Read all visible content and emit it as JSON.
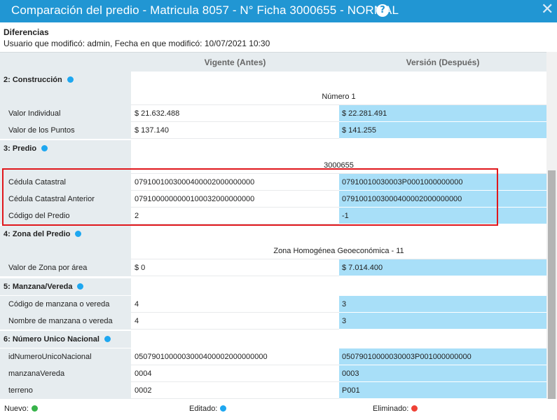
{
  "window": {
    "title": "Comparación del predio - Matricula 8057 - N° Ficha 3000655 - NORMAL",
    "help_icon": "?",
    "close_icon": "✕"
  },
  "info": {
    "heading": "Diferencias",
    "user_line": "Usuario que modificó: admin, Fecha en que modificó: 10/07/2021 10:30"
  },
  "columns": {
    "before": "Vigente (Antes)",
    "after": "Versión (Después)"
  },
  "sections": {
    "s2": {
      "title": "2: Construcción",
      "sub": "Número 1"
    },
    "s3": {
      "title": "3: Predio",
      "sub": "3000655"
    },
    "s4": {
      "title": "4: Zona del Predio",
      "sub": "Zona Homogénea Geoeconómica - 11"
    },
    "s5": {
      "title": "5: Manzana/Vereda"
    },
    "s6": {
      "title": "6: Número Unico Nacional"
    }
  },
  "rows": {
    "valor_individual": {
      "label": "Valor Individual",
      "before": "$ 21.632.488",
      "after": "$ 22.281.491"
    },
    "valor_puntos": {
      "label": "Valor de los Puntos",
      "before": "$ 137.140",
      "after": "$ 141.255"
    },
    "cedula": {
      "label": "Cédula Catastral",
      "before": "0791001003000400002000000000",
      "after": "07910010030003P0001000000000"
    },
    "cedula_ant": {
      "label": "Cédula Catastral Anterior",
      "before": "0791000000000100032000000000",
      "after": "0791001003000400002000000000"
    },
    "codigo_predio": {
      "label": "Código del Predio",
      "before": "2",
      "after": "-1"
    },
    "valor_zona": {
      "label": "Valor de Zona por área",
      "before": "$ 0",
      "after": "$ 7.014.400"
    },
    "codigo_manzana": {
      "label": "Código de manzana o vereda",
      "before": "4",
      "after": "3"
    },
    "nombre_manzana": {
      "label": "Nombre de manzana o vereda",
      "before": "4",
      "after": "3"
    },
    "id_unico": {
      "label": "idNumeroUnicoNacional",
      "before": "0507901000003000400002000000000",
      "after": "05079010000030003P001000000000"
    },
    "manzana_vereda": {
      "label": "manzanaVereda",
      "before": "0004",
      "after": "0003"
    },
    "terreno": {
      "label": "terreno",
      "before": "0002",
      "after": "P001"
    }
  },
  "legend": {
    "nuevo": "Nuevo:",
    "editado": "Editado:",
    "eliminado": "Eliminado:"
  },
  "colors": {
    "titlebar": "#2196d3",
    "changed_cell": "#a8dff8",
    "dot_edit": "#1ea7f0",
    "dot_new": "#37b34a",
    "dot_deleted": "#ef4136",
    "highlight": "#e0171c"
  }
}
